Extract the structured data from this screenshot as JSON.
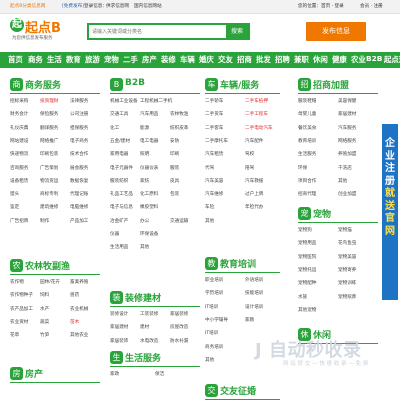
{
  "topbar": {
    "notice": "起点B分类信息网",
    "free_post": "[免费发布]",
    "login_links": "登录信息：",
    "help": "供求信息网",
    "help2": "国内信息网站",
    "right_links": "您的位置：首页 · 登录",
    "right_links2": "会员 · 注册"
  },
  "header": {
    "logo_mark": "起",
    "logo_title": "起点B",
    "slogan": "为您供信息发布服务",
    "search_placeholder": "请输入关键词或分类名",
    "search_button": "搜索",
    "post_button": "发布信息"
  },
  "nav": [
    "首页",
    "商务",
    "生活",
    "教育",
    "旅游",
    "宠物",
    "二手",
    "房产",
    "装修",
    "车辆",
    "婚庆",
    "交友",
    "招商",
    "批发",
    "招聘",
    "兼职",
    "休闲",
    "健康",
    "农业",
    "B2B",
    "起点通"
  ],
  "sections": {
    "business": {
      "icon": "商",
      "title": "商务服务",
      "items": [
        [
          "招标采购",
          "投资理财",
          "法律服务"
        ],
        [
          "财务会计",
          "保险服务",
          "公司注册"
        ],
        [
          "礼仪庆典",
          "翻译服务",
          "担保服务"
        ],
        [
          "网站建设",
          "网络推广",
          "电子商务"
        ],
        [
          "快递物流",
          "印刷包装",
          "技术合作"
        ],
        [
          "咨询服务",
          "广告策划",
          "展会服务"
        ],
        [
          "设备租赁",
          "物流货运",
          "数据恢复"
        ],
        [
          "猎头",
          "商标专利",
          "代理记账"
        ],
        [
          "鉴定",
          "建筑维修",
          "电脑维修"
        ],
        [
          "广告招牌",
          "制作",
          "产品加工"
        ]
      ]
    },
    "farm": {
      "icon": "农",
      "title": "农林牧副渔",
      "items": [
        [
          "农作物",
          "园林/花卉",
          "畜禽养殖"
        ],
        [
          "农作物种子",
          "饲料",
          "兽药"
        ],
        [
          "农产品加工",
          "水产",
          "农业机械"
        ],
        [
          "农业资材",
          "蔬菜",
          "苗木"
        ],
        [
          "花草",
          "竹笋",
          "其他农业"
        ]
      ]
    },
    "house": {
      "icon": "房",
      "title": "房产",
      "items": []
    },
    "b2b": {
      "icon": "B",
      "title": "B2B",
      "items": [
        [
          "机械工业设备",
          "工程机械二手机"
        ],
        [
          "交通工具",
          "汽车用品",
          "农林牧渔"
        ],
        [
          "化工",
          "能源",
          "纺织皮革"
        ],
        [
          "五金/建材",
          "电工电器",
          "安防"
        ],
        [
          "家用电器",
          "照明",
          "印刷"
        ],
        [
          "电子元器件",
          "仪器仪表",
          "服装"
        ],
        [
          "服装纺织",
          "家纺",
          "皮具"
        ],
        [
          "礼品工艺品",
          "化工原料",
          "包装"
        ],
        [
          "电子与信息",
          "橡胶塑料"
        ],
        [
          "冶金矿产",
          "办公",
          "交通运输"
        ],
        [
          "仪器",
          "环保设备"
        ],
        [
          "生活用品",
          "其他"
        ]
      ]
    },
    "decor": {
      "icon": "装",
      "title": "装修建材",
      "items": [
        [
          "装修设计",
          "工装装修",
          "家居装修"
        ],
        [
          "家居建材",
          "建材",
          "房屋改造"
        ],
        [
          "家居装饰",
          "水电改造",
          "防水补漏"
        ]
      ]
    },
    "life": {
      "icon": "生",
      "title": "生活服务",
      "items": [
        [
          "家政",
          "保洁"
        ]
      ]
    },
    "vehicle": {
      "icon": "车",
      "title": "车辆/服务",
      "items": [
        [
          "二手轿车",
          "二手车抵押"
        ],
        [
          "二手货车",
          "二手工程车"
        ],
        [
          "二手客车",
          "二手电动汽车"
        ],
        [
          "二手摩托车",
          "汽车配件"
        ],
        [
          "汽车租赁",
          "驾校"
        ],
        [
          "代驾",
          "陪驾"
        ],
        [
          "汽车美容",
          "汽车救援"
        ],
        [
          "汽车维修",
          "过户上牌"
        ],
        [
          "车险",
          "年检代办"
        ],
        [
          "其他"
        ]
      ]
    },
    "edu": {
      "icon": "教",
      "title": "教育培训",
      "items": [
        [
          "职业培训",
          "外语培训"
        ],
        [
          "学历培训",
          "技能培训"
        ],
        [
          "IT培训",
          "设计培训"
        ],
        [
          "中小学辅导",
          "家教"
        ],
        [
          "IT培训"
        ],
        [
          "商务培训"
        ],
        [
          "其他"
        ]
      ]
    },
    "social": {
      "icon": "交",
      "title": "交友征婚",
      "items": []
    },
    "franchise": {
      "icon": "招",
      "title": "招商加盟",
      "items": [
        [
          "服装鞋帽",
          "美容保健"
        ],
        [
          "母婴儿童",
          "家居建材"
        ],
        [
          "餐饮美食",
          "汽车服务"
        ],
        [
          "教育培训",
          "网络服务"
        ],
        [
          "生活服务",
          "养殖加盟"
        ],
        [
          "环保",
          "干洗店"
        ],
        [
          "项目合作",
          "其他"
        ],
        [
          "招商代理",
          "创业加盟"
        ]
      ]
    },
    "pets": {
      "icon": "宠",
      "title": "宠物",
      "items": [
        [
          "宠物狗",
          "宠物猫"
        ],
        [
          "宠物用品",
          "花鸟鱼虫"
        ],
        [
          "宠物医院",
          "宠物美容"
        ],
        [
          "宠物托运",
          "宠物寄养"
        ],
        [
          "宠物配种",
          "宠物训练"
        ],
        [
          "水族",
          "宠物殡葬"
        ],
        [
          "其他宠物"
        ]
      ]
    },
    "leisure": {
      "icon": "休",
      "title": "休闲",
      "items": []
    }
  },
  "banner": {
    "line1": [
      "企",
      "业",
      "注",
      "册"
    ],
    "line2": [
      "就",
      "送",
      "官",
      "网"
    ]
  },
  "watermark": {
    "big": "J 自动秒收录",
    "small": "网 站 提 交 — 快 速 收 录 — 免 费"
  }
}
